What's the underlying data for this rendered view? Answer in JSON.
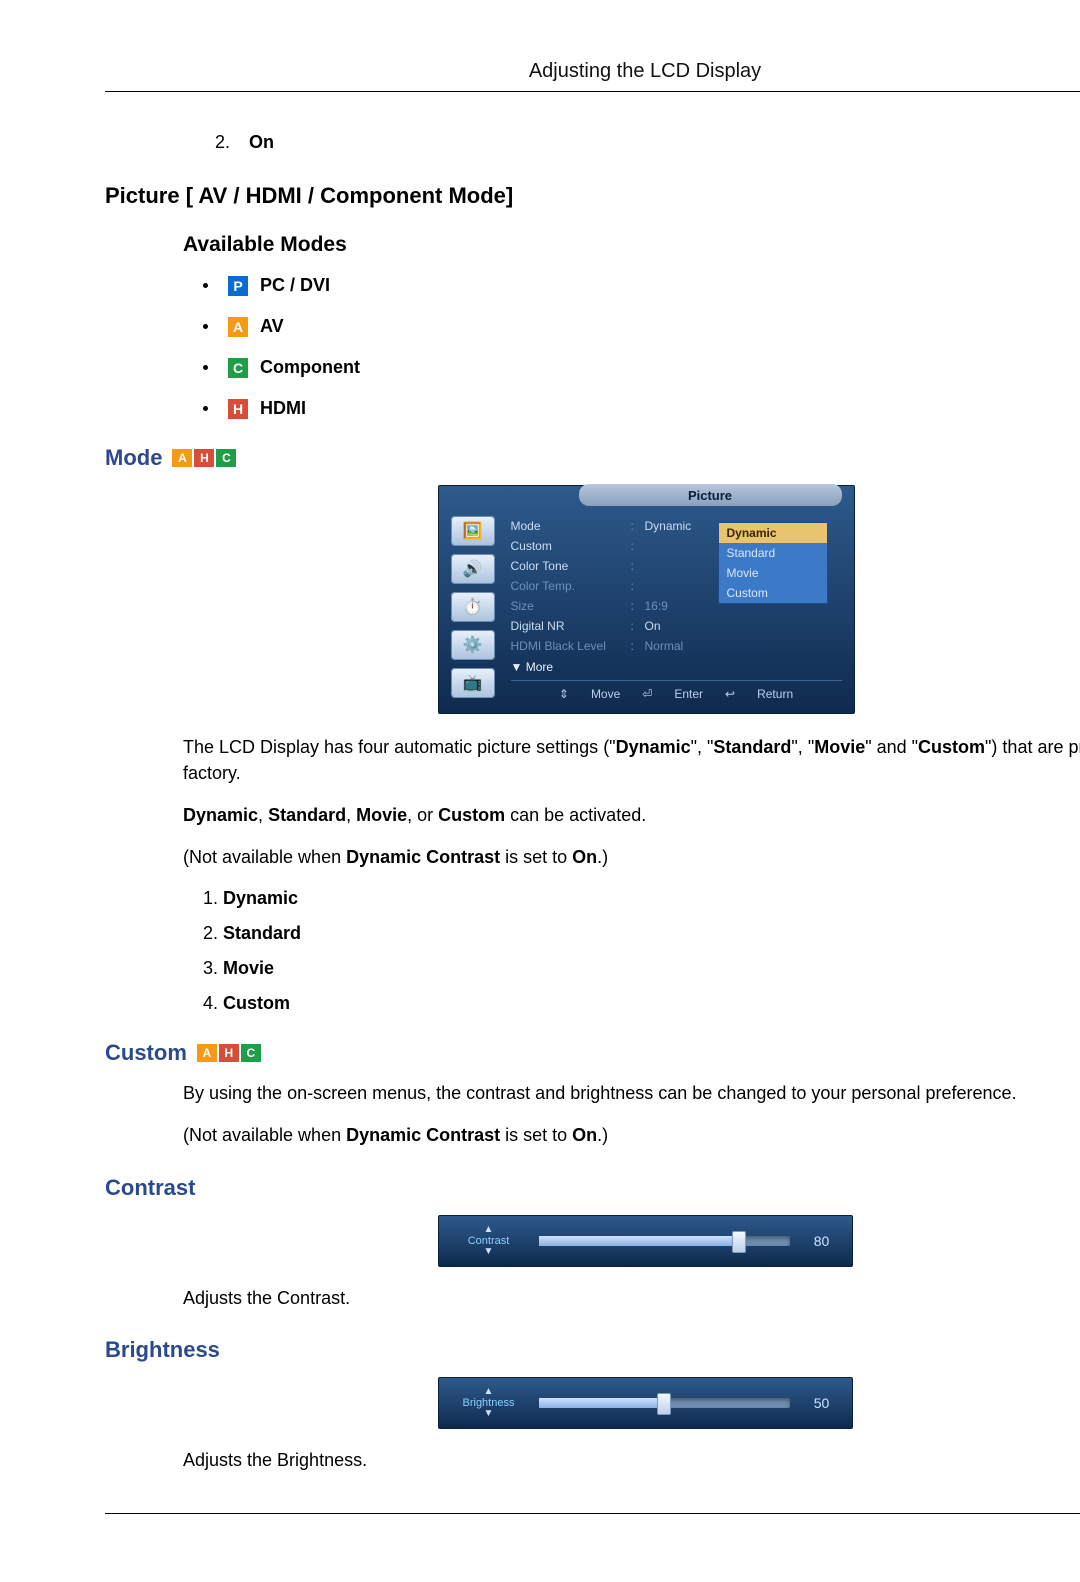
{
  "header": {
    "title": "Adjusting the LCD Display"
  },
  "top_item": {
    "num": "2.",
    "label": "On"
  },
  "sections": {
    "picture_modes_title": "Picture [ AV / HDMI / Component Mode]",
    "available_modes_title": "Available Modes",
    "mode_title": "Mode",
    "custom_title": "Custom",
    "contrast_title": "Contrast",
    "brightness_title": "Brightness"
  },
  "available_modes": {
    "p": {
      "glyph": "P",
      "label": "PC / DVI"
    },
    "a": {
      "glyph": "A",
      "label": "AV"
    },
    "c": {
      "glyph": "C",
      "label": "Component"
    },
    "h": {
      "glyph": "H",
      "label": "HDMI"
    }
  },
  "osd": {
    "title": "Picture",
    "left_tabs_glyphs": [
      "🖼️",
      "🔊",
      "⏱️",
      "⚙️",
      "📺"
    ],
    "rows": {
      "mode": {
        "label": "Mode",
        "value": "Dynamic",
        "dim": false
      },
      "custom": {
        "label": "Custom",
        "value": "",
        "dim": false
      },
      "color_tone": {
        "label": "Color Tone",
        "value": "",
        "dim": false
      },
      "color_temp": {
        "label": "Color Temp.",
        "value": "",
        "dim": true
      },
      "size": {
        "label": "Size",
        "value": "16:9",
        "dim": true
      },
      "digital_nr": {
        "label": "Digital NR",
        "value": "On",
        "dim": false
      },
      "hdmi_black": {
        "label": "HDMI Black Level",
        "value": "Normal",
        "dim": true
      }
    },
    "more": "More",
    "dropdown": [
      "Dynamic",
      "Standard",
      "Movie",
      "Custom"
    ],
    "dropdown_selected_index": 0,
    "footer": {
      "move": "Move",
      "enter": "Enter",
      "return": "Return"
    }
  },
  "mode_text": {
    "p1_a": "The LCD Display has four automatic picture settings (\"",
    "p1_b": "Dynamic",
    "p1_c": "\", \"",
    "p1_d": "Standard",
    "p1_e": "\", \"",
    "p1_f": "Movie",
    "p1_g": "\" and \"",
    "p1_h": "Custom",
    "p1_i": "\") that are preset at the factory.",
    "p2_a": "Dynamic",
    "p2_b": ", ",
    "p2_c": "Standard",
    "p2_d": ", ",
    "p2_e": "Movie",
    "p2_f": ", or ",
    "p2_g": "Custom",
    "p2_h": " can be activated.",
    "p3_a": "(Not available when ",
    "p3_b": "Dynamic Contrast",
    "p3_c": " is set to ",
    "p3_d": "On",
    "p3_e": ".)",
    "list": {
      "i1": "Dynamic",
      "i2": "Standard",
      "i3": "Movie",
      "i4": "Custom"
    }
  },
  "custom_text": {
    "p1": "By using the on-screen menus, the contrast and brightness can be changed to your personal preference.",
    "p2_a": "(Not available when ",
    "p2_b": "Dynamic Contrast",
    "p2_c": " is set to ",
    "p2_d": "On",
    "p2_e": ".)"
  },
  "contrast": {
    "slider_label": "Contrast",
    "value": 80,
    "value_label": "80",
    "desc": "Adjusts the Contrast."
  },
  "brightness": {
    "slider_label": "Brightness",
    "value": 50,
    "value_label": "50",
    "desc": "Adjusts the Brightness."
  }
}
